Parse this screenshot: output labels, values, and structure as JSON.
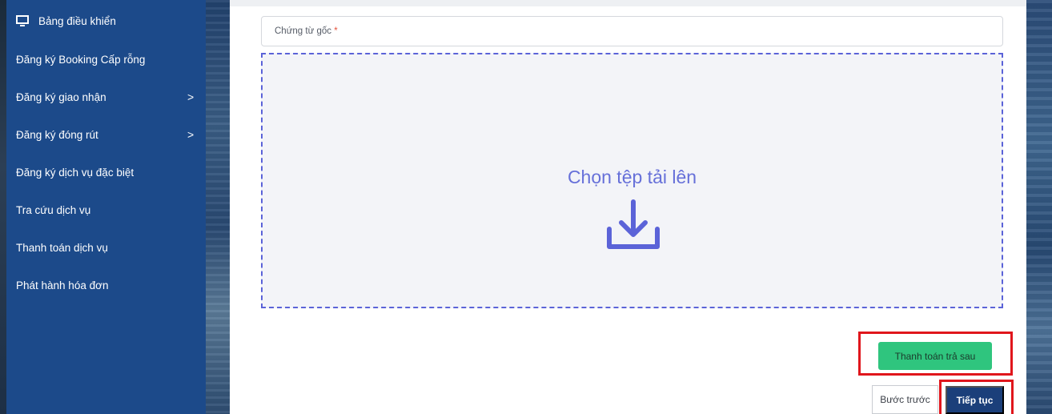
{
  "sidebar": {
    "items": [
      {
        "label": "Bảng điều khiển",
        "icon": "monitor-icon"
      },
      {
        "label": "Đăng ký Booking Cấp rỗng"
      },
      {
        "label": "Đăng ký giao nhận",
        "has_submenu": true
      },
      {
        "label": "Đăng ký đóng rút",
        "has_submenu": true
      },
      {
        "label": "Đăng ký dịch vụ đặc biệt"
      },
      {
        "label": "Tra cứu dịch vụ"
      },
      {
        "label": "Thanh toán dịch vụ"
      },
      {
        "label": "Phát hành hóa đơn"
      }
    ],
    "chevron": ">",
    "background": "#1c4a8a"
  },
  "form": {
    "field_label": "Chứng từ gốc",
    "required_mark": "*",
    "dropzone_text": "Chọn tệp tải lên",
    "dropzone_icon": "download-icon"
  },
  "buttons": {
    "pay_later": "Thanh toán trả sau",
    "back": "Bước trước",
    "next": "Tiếp tục"
  },
  "colors": {
    "accent": "#5b63d8",
    "pay_later_bg": "#2fc57e",
    "next_bg": "#1b3f7a",
    "highlight": "#e0161c"
  }
}
